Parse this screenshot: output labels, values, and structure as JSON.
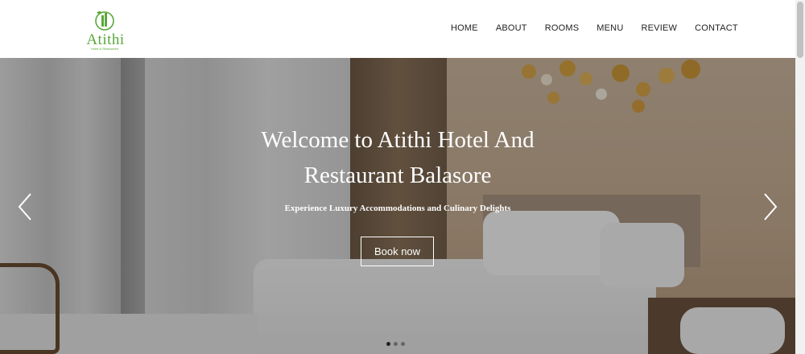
{
  "brand": {
    "name": "Atithi",
    "tagline": "Hotel & Restaurant",
    "color": "#5aa83a"
  },
  "nav": {
    "items": [
      {
        "label": "HOME"
      },
      {
        "label": "ABOUT"
      },
      {
        "label": "ROOMS"
      },
      {
        "label": "MENU"
      },
      {
        "label": "REVIEW"
      },
      {
        "label": "CONTACT"
      }
    ]
  },
  "hero": {
    "title_line1": "Welcome to Atithi Hotel And",
    "title_line2": "Restaurant Balasore",
    "subtitle": "Experience Luxury Accommodations and Culinary Delights",
    "button_label": "Book now",
    "prev_icon": "chevron-left-icon",
    "next_icon": "chevron-right-icon",
    "slides_count": 3,
    "active_slide": 1
  }
}
